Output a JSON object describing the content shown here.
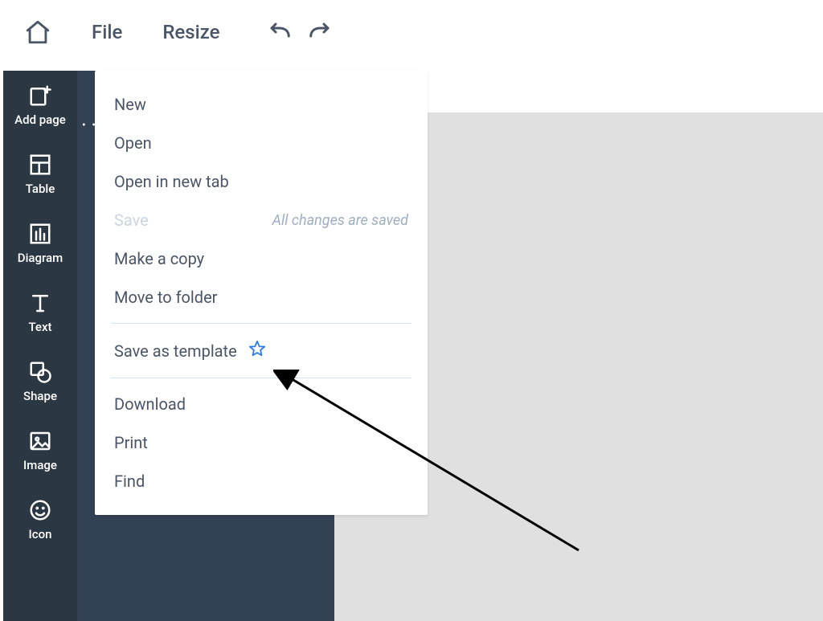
{
  "topbar": {
    "menus": {
      "file": "File",
      "resize": "Resize"
    }
  },
  "sidebar": {
    "items": [
      {
        "label": "Add page"
      },
      {
        "label": "Table"
      },
      {
        "label": "Diagram"
      },
      {
        "label": "Text"
      },
      {
        "label": "Shape"
      },
      {
        "label": "Image"
      },
      {
        "label": "Icon"
      }
    ]
  },
  "fileMenu": {
    "new": "New",
    "open": "Open",
    "openNewTab": "Open in new tab",
    "save": "Save",
    "saveHint": "All changes are saved",
    "makeCopy": "Make a copy",
    "moveFolder": "Move to folder",
    "saveTemplate": "Save as template",
    "download": "Download",
    "print": "Print",
    "find": "Find"
  }
}
